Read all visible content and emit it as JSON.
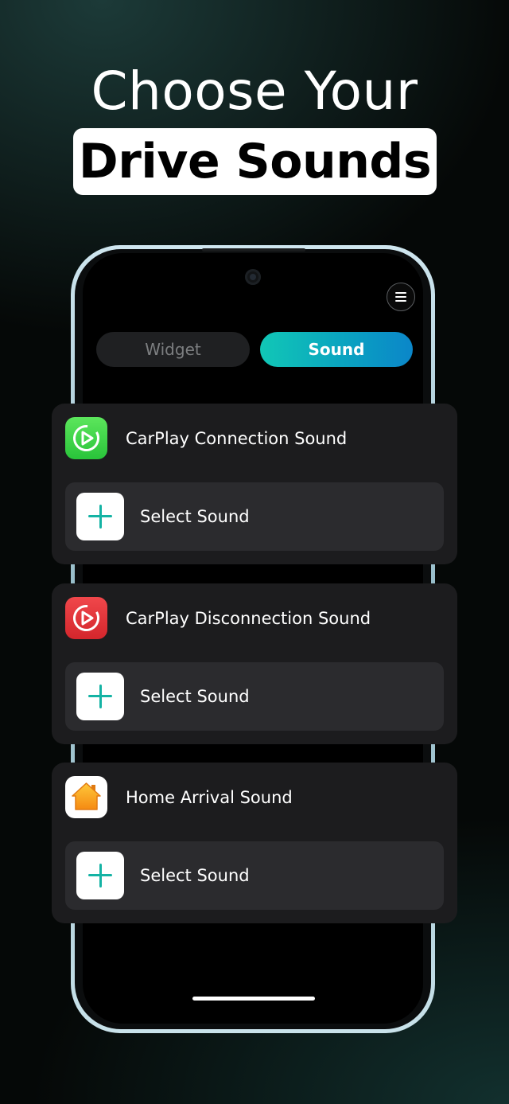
{
  "headline": {
    "line1": "Choose Your",
    "line2": "Drive Sounds"
  },
  "tabs": [
    {
      "label": "Widget",
      "active": false
    },
    {
      "label": "Sound",
      "active": true
    }
  ],
  "menu_icon": "hamburger-menu-icon",
  "cards": [
    {
      "title": "CarPlay Connection Sound",
      "icon": "carplay-icon",
      "icon_color": "#34c84a",
      "select_label": "Select Sound"
    },
    {
      "title": "CarPlay Disconnection Sound",
      "icon": "carplay-icon",
      "icon_color": "#e5363b",
      "select_label": "Select Sound"
    },
    {
      "title": "Home Arrival Sound",
      "icon": "home-icon",
      "icon_color": "#f7a21c",
      "select_label": "Select Sound"
    }
  ],
  "colors": {
    "accent_gradient_start": "#11c7b6",
    "accent_gradient_end": "#0b86c9",
    "plus_color": "#14b3a4",
    "card_background": "#1c1c1e"
  }
}
